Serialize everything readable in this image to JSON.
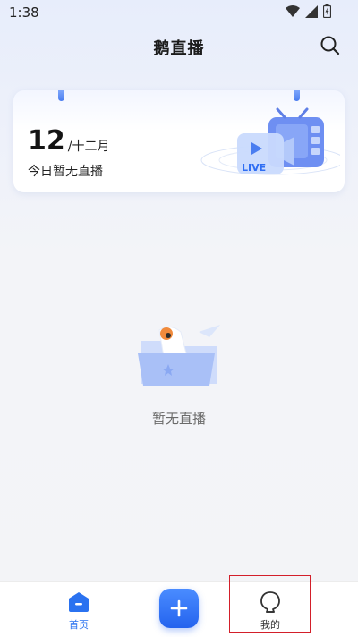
{
  "status_bar": {
    "time": "1:38"
  },
  "header": {
    "title": "鹅直播"
  },
  "calendar": {
    "day": "12",
    "month": "/十二月",
    "status": "今日暂无直播"
  },
  "live_badge": "LIVE",
  "empty_state": {
    "text": "暂无直播"
  },
  "bottom_nav": {
    "home_label": "首页",
    "mine_label": "我的"
  },
  "colors": {
    "accent": "#2a72f0",
    "highlight": "#d31f2a"
  },
  "icons": [
    "wifi-icon",
    "signal-icon",
    "battery-icon",
    "search-icon",
    "home-icon",
    "plus-icon",
    "profile-icon"
  ]
}
